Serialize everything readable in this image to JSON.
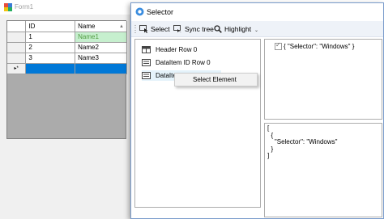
{
  "form1": {
    "title": "Form1",
    "grid": {
      "columns": [
        "ID",
        "Name"
      ],
      "rows": [
        {
          "id": "1",
          "name": "Name1"
        },
        {
          "id": "2",
          "name": "Name2"
        },
        {
          "id": "3",
          "name": "Name3"
        }
      ],
      "new_row_marker": "▸*"
    }
  },
  "selector": {
    "title": "Selector",
    "toolbar": {
      "select_label": "Select",
      "sync_label": "Sync tree",
      "highlight_label": "Highlight",
      "overflow": "⌄"
    },
    "tree": {
      "items": [
        {
          "label": "Header Row 0",
          "icon": "table-header-icon"
        },
        {
          "label": "DataItem ID Row 0",
          "icon": "data-item-icon"
        },
        {
          "label": "DataItem Name Row 0",
          "icon": "data-item-icon"
        }
      ]
    },
    "context_menu": {
      "items": [
        {
          "label": "Select Element"
        }
      ]
    },
    "properties": {
      "row": "{ \"Selector\": \"Windows\" }"
    },
    "json": {
      "lines": [
        "[",
        "  {",
        "    \"Selector\": \"Windows\"",
        "  }",
        "]"
      ]
    }
  },
  "colors": {
    "selection_blue": "#0078d7",
    "highlight_green_bg": "#c6efce",
    "highlight_green_text": "#4f9a3f"
  }
}
